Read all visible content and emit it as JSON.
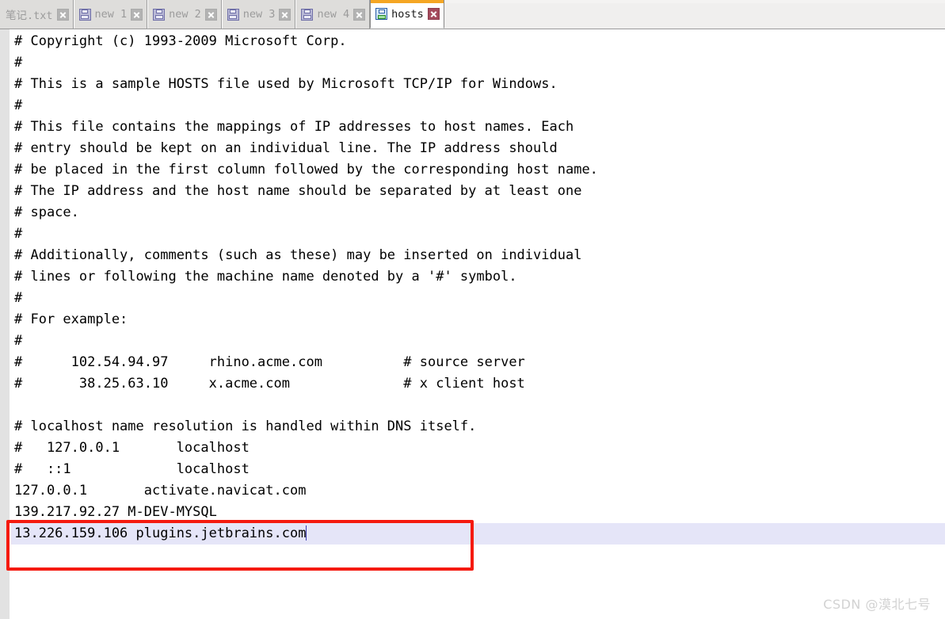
{
  "window": {
    "app_kind": "text-editor",
    "accent_active_tab_color": "#f5a623",
    "current_line_highlight_color": "#e5e5f8",
    "annotation_color": "#f51a0f"
  },
  "tabbar": {
    "tabs": [
      {
        "label": "笔记.txt",
        "icon": "floppy-disk-icon",
        "close_label": "x",
        "active": false,
        "truncated_left": true
      },
      {
        "label": "new 1",
        "icon": "floppy-disk-icon",
        "close_label": "x",
        "active": false,
        "truncated_left": false
      },
      {
        "label": "new 2",
        "icon": "floppy-disk-icon",
        "close_label": "x",
        "active": false,
        "truncated_left": false
      },
      {
        "label": "new 3",
        "icon": "floppy-disk-icon",
        "close_label": "x",
        "active": false,
        "truncated_left": false
      },
      {
        "label": "new 4",
        "icon": "floppy-disk-icon",
        "close_label": "x",
        "active": false,
        "truncated_left": false
      },
      {
        "label": "hosts",
        "icon": "floppy-disk-icon",
        "close_label": "x",
        "active": true,
        "truncated_left": false
      }
    ]
  },
  "editor": {
    "filename": "hosts",
    "current_line_index": 25,
    "lines": [
      "# Copyright (c) 1993-2009 Microsoft Corp.",
      "#",
      "# This is a sample HOSTS file used by Microsoft TCP/IP for Windows.",
      "#",
      "# This file contains the mappings of IP addresses to host names. Each",
      "# entry should be kept on an individual line. The IP address should",
      "# be placed in the first column followed by the corresponding host name.",
      "# The IP address and the host name should be separated by at least one",
      "# space.",
      "#",
      "# Additionally, comments (such as these) may be inserted on individual",
      "# lines or following the machine name denoted by a '#' symbol.",
      "#",
      "# For example:",
      "#",
      "#      102.54.94.97     rhino.acme.com          # source server",
      "#       38.25.63.10     x.acme.com              # x client host",
      "",
      "# localhost name resolution is handled within DNS itself.",
      "#   127.0.0.1       localhost",
      "#   ::1             localhost",
      "127.0.0.1       activate.navicat.com",
      "139.217.92.27 M-DEV-MYSQL",
      "13.226.159.106 plugins.jetbrains.com",
      "",
      ""
    ],
    "highlighted_line_text": "13.226.159.106 plugins.jetbrains.com"
  },
  "watermark": {
    "text": "CSDN @漠北七号"
  }
}
